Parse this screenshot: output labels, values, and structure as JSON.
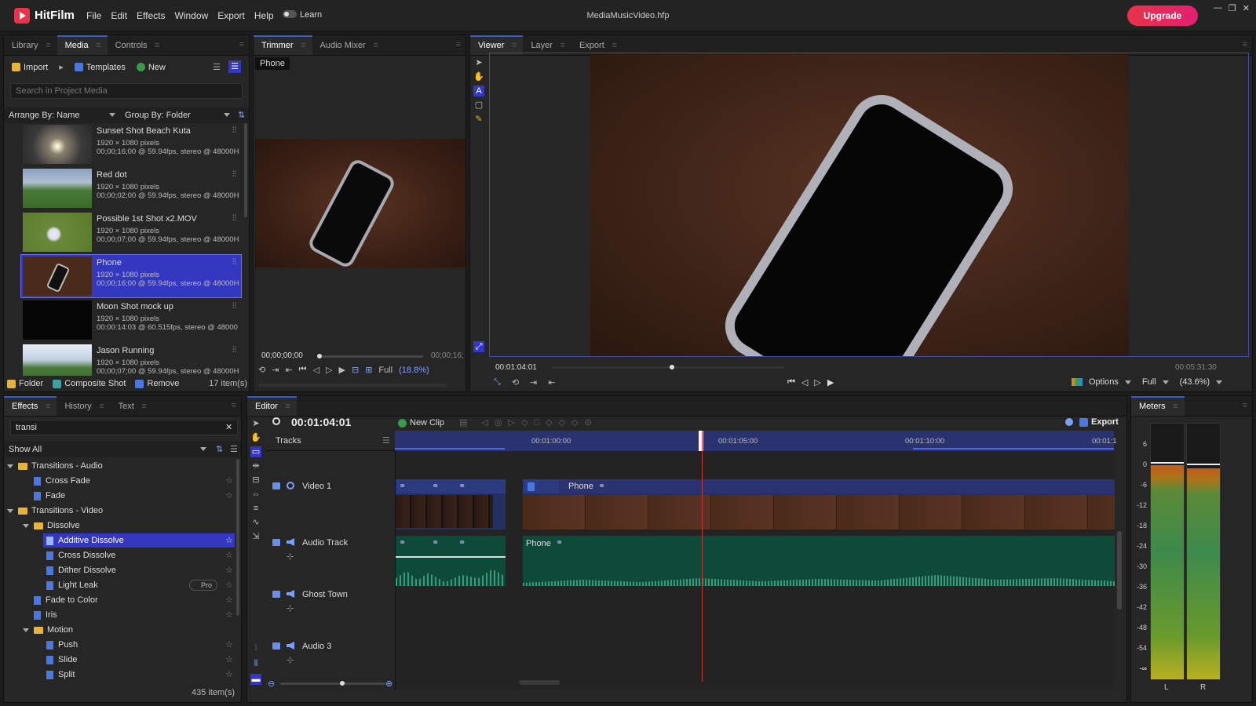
{
  "app": {
    "brand": "HitFilm",
    "menu": [
      "File",
      "Edit",
      "Effects",
      "Window",
      "Export",
      "Help"
    ],
    "learn": "Learn",
    "file_title": "MediaMusicVideo.hfp",
    "upgrade": "Upgrade",
    "accent": "#3438c0",
    "brand_color": "#e8344a"
  },
  "media_panel": {
    "tabs": [
      "Library",
      "Media",
      "Controls"
    ],
    "import": "Import",
    "templates": "Templates",
    "new": "New",
    "search_placeholder": "Search in Project Media",
    "arrange": "Arrange By: Name",
    "group": "Group By: Folder",
    "items": [
      {
        "name": "Sunset Shot Beach Kuta",
        "res": "1920 × 1080 pixels",
        "info": "00;00;16;00 @ 59.94fps, stereo @ 48000H"
      },
      {
        "name": "Red dot",
        "res": "1920 × 1080 pixels",
        "info": "00;00;02;00 @ 59.94fps, stereo @ 48000H"
      },
      {
        "name": "Possible 1st Shot x2.MOV",
        "res": "1920 × 1080 pixels",
        "info": "00;00;07;00 @ 59.94fps, stereo @ 48000H"
      },
      {
        "name": "Phone",
        "res": "1920 × 1080 pixels",
        "info": "00;00;16;00 @ 59.94fps, stereo @ 48000H"
      },
      {
        "name": "Moon Shot mock up",
        "res": "1920 × 1080 pixels",
        "info": "00:00:14:03 @ 60.515fps, stereo @ 48000"
      },
      {
        "name": "Jason Running",
        "res": "1920 × 1080 pixels",
        "info": "00;00;07;00 @ 59.94fps, stereo @ 48000H"
      }
    ],
    "folder": "Folder",
    "composite": "Composite Shot",
    "remove": "Remove",
    "count": "17 item(s)"
  },
  "trimmer": {
    "tabs": [
      "Trimmer",
      "Audio Mixer"
    ],
    "clip_label": "Phone",
    "time_start": "00;00;00;00",
    "time_end": "00;00;16;",
    "quality": "Full",
    "zoom": "(18.8%)"
  },
  "viewer": {
    "tabs": [
      "Viewer",
      "Layer",
      "Export"
    ],
    "time": "00:01:04:01",
    "end_time": "00:05:31:30",
    "options": "Options",
    "quality": "Full",
    "zoom": "(43.6%)"
  },
  "effects_panel": {
    "tabs": [
      "Effects",
      "History",
      "Text"
    ],
    "search_value": "transi",
    "show": "Show All",
    "tree": [
      {
        "label": "Transitions - Audio",
        "type": "folder",
        "level": 0
      },
      {
        "label": "Cross Fade",
        "type": "file",
        "level": 1
      },
      {
        "label": "Fade",
        "type": "file",
        "level": 1
      },
      {
        "label": "Transitions - Video",
        "type": "folder",
        "level": 0
      },
      {
        "label": "Dissolve",
        "type": "folder",
        "level": 1
      },
      {
        "label": "Additive Dissolve",
        "type": "file",
        "level": 2,
        "selected": true
      },
      {
        "label": "Cross Dissolve",
        "type": "file",
        "level": 2
      },
      {
        "label": "Dither Dissolve",
        "type": "file",
        "level": 2
      },
      {
        "label": "Light Leak",
        "type": "file",
        "level": 2,
        "badge": "Pro"
      },
      {
        "label": "Fade to Color",
        "type": "file",
        "level": 1
      },
      {
        "label": "Iris",
        "type": "file",
        "level": 1
      },
      {
        "label": "Motion",
        "type": "folder",
        "level": 1
      },
      {
        "label": "Push",
        "type": "file",
        "level": 2
      },
      {
        "label": "Slide",
        "type": "file",
        "level": 2
      },
      {
        "label": "Split",
        "type": "file",
        "level": 2
      }
    ],
    "count": "435 item(s)"
  },
  "editor": {
    "tab": "Editor",
    "timecode": "00:01:04:01",
    "new_clip": "New Clip",
    "export": "Export",
    "tracks_label": "Tracks",
    "ruler": [
      "00:01:00:00",
      "00:01:05:00",
      "00:01:10:00",
      "00:01:1"
    ],
    "tracks": [
      "Video 1",
      "Audio Track",
      "Ghost Town",
      "Audio 3"
    ],
    "clip_video": "Phone",
    "clip_audio": "Phone"
  },
  "meters": {
    "tab": "Meters",
    "ch_top": [
      "0",
      "-1"
    ],
    "scale": [
      "6",
      "0",
      "-6",
      "-12",
      "-18",
      "-24",
      "-30",
      "-36",
      "-42",
      "-48",
      "-54",
      "-∞"
    ],
    "ch_bottom": [
      "L",
      "R"
    ]
  }
}
